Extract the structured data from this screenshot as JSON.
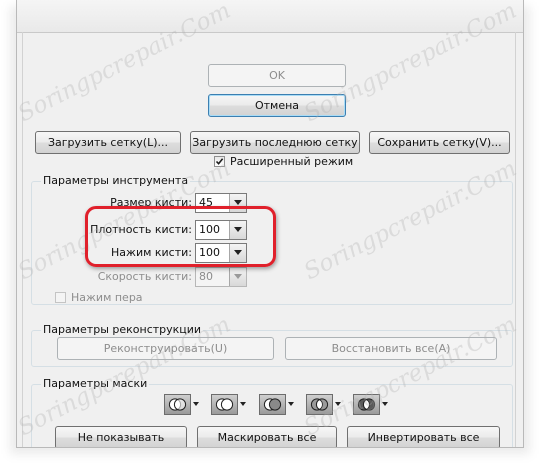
{
  "buttons": {
    "ok": "OK",
    "cancel": "Отмена",
    "load_mesh": "Загрузить сетку(L)...",
    "load_last_mesh": "Загрузить последнюю сетку",
    "save_mesh": "Сохранить сетку(V)..."
  },
  "advanced_mode": {
    "label": "Расширенный режим",
    "checked": true
  },
  "tool_options": {
    "title": "Параметры инструмента",
    "brush_size": {
      "label": "Размер кисти:",
      "value": "45"
    },
    "brush_density": {
      "label": "Плотность кисти:",
      "value": "100"
    },
    "brush_pressure": {
      "label": "Нажим кисти:",
      "value": "100"
    },
    "brush_rate": {
      "label": "Скорость кисти:",
      "value": "80"
    },
    "stylus_pressure": {
      "label": "Нажим пера",
      "checked": false
    }
  },
  "reconstruct_options": {
    "title": "Параметры реконструкции",
    "reconstruct": "Реконструировать(U)",
    "restore_all": "Восстановить все(A)"
  },
  "mask_options": {
    "title": "Параметры маски",
    "icons": [
      "replace-selection-icon",
      "add-to-selection-icon",
      "subtract-from-selection-icon",
      "intersect-selection-icon",
      "invert-selection-icon"
    ],
    "none": "Не показывать",
    "mask_all": "Маскировать все",
    "invert_all": "Инвертировать все"
  },
  "watermark": "Soringpcrepair.Com",
  "colors": {
    "highlight": "#e0202b",
    "default_button": "#3c7fb1"
  }
}
